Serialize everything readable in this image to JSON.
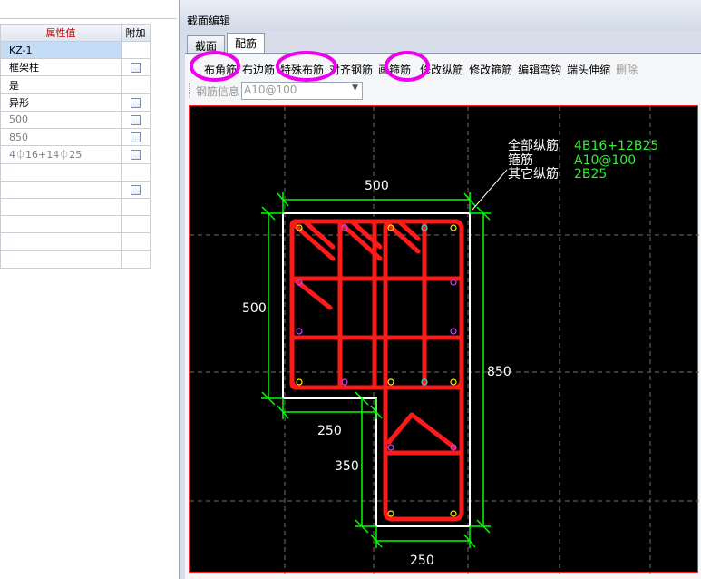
{
  "property_table": {
    "headers": {
      "value": "属性值",
      "addition": "附加"
    },
    "rows": [
      {
        "value": "KZ-1",
        "gray": false,
        "checkbox": false
      },
      {
        "value": "框架柱",
        "gray": false,
        "checkbox": true
      },
      {
        "value": "是",
        "gray": false,
        "checkbox": false
      },
      {
        "value": "异形",
        "gray": false,
        "checkbox": true
      },
      {
        "value": "500",
        "gray": true,
        "checkbox": true
      },
      {
        "value": "850",
        "gray": true,
        "checkbox": true
      },
      {
        "value": "4⏀16+14⏀25",
        "gray": true,
        "checkbox": true
      },
      {
        "value": "",
        "gray": false,
        "checkbox": false
      },
      {
        "value": "",
        "gray": false,
        "checkbox": true
      },
      {
        "value": "",
        "gray": false,
        "checkbox": false
      },
      {
        "value": "",
        "gray": false,
        "checkbox": false
      },
      {
        "value": "",
        "gray": false,
        "checkbox": false
      },
      {
        "value": "",
        "gray": false,
        "checkbox": false
      }
    ]
  },
  "dialog": {
    "title": "截面编辑",
    "tabs": {
      "section": "截面",
      "rebar": "配筋"
    },
    "toolbar": {
      "corner_rebar": "布角筋",
      "edge_rebar": "布边筋",
      "special_rebar": "特殊布筋",
      "align_rebar": "对齐钢筋",
      "draw_stirrup": "画箍筋",
      "modify_long_rebar": "修改纵筋",
      "modify_stirrup": "修改箍筋",
      "edit_hook": "编辑弯钩",
      "end_extend": "端头伸缩",
      "delete": "删除"
    },
    "rebar_info_label": "钢筋信息",
    "rebar_info_value": "A10@100"
  },
  "drawing": {
    "legend": {
      "all_long_label": "全部纵筋",
      "all_long_value": "4B16+12B25",
      "stirrup_label": "箍筋",
      "stirrup_value": "A10@100",
      "other_long_label": "其它纵筋",
      "other_long_value": "2B25"
    },
    "dimensions": {
      "top_width": "500",
      "left_height": "500",
      "right_height": "850",
      "mid_width": "250",
      "leg_height": "350",
      "bottom_width": "250"
    },
    "colors": {
      "background": "#000000",
      "stirrup": "#ff1a1a",
      "outline": "#ffffff",
      "dimension": "#00ff00",
      "highlight": "#ee00ee",
      "label_value": "#33ee33"
    }
  }
}
